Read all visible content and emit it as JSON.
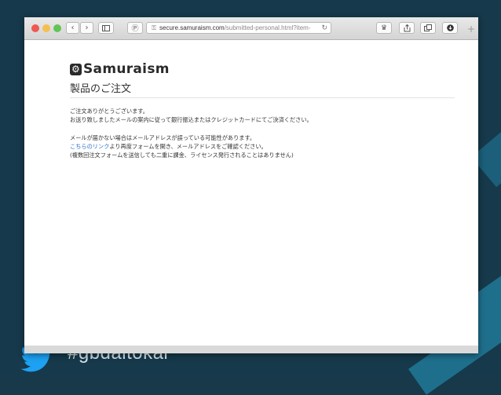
{
  "browser": {
    "url_host": "secure.samuraism.com",
    "url_path": "/submitted-personal.html?item-"
  },
  "page": {
    "logo_text": "Samuraism",
    "title": "製品のご注文",
    "paragraph1": {
      "line1": "ご注文ありがとうございます。",
      "line2": "お送り致しましたメールの案内に従って銀行振込またはクレジットカードにてご決済ください。"
    },
    "paragraph2": {
      "line1": "メールが届かない場合はメールアドレスが誤っている可能性があります。",
      "link_text": "こちらのリンク",
      "line2_rest": "より再度フォームを開き、メールアドレスをご確認ください。",
      "line3": "(複数回注文フォームを送信しても二重に課金、ライセンス発行されることはありません)"
    }
  },
  "slide": {
    "hashtag": "#gbdaitokai"
  },
  "colors": {
    "background": "#16394b",
    "accent_stripe": "#1e6f8c",
    "link": "#2a6fc9",
    "twitter": "#1da1f2"
  },
  "icons": [
    "back-arrow-icon",
    "forward-arrow-icon",
    "sidebar-icon",
    "reader-icon",
    "lock-icon",
    "reload-icon",
    "extension-icon",
    "share-icon",
    "tabs-icon",
    "download-icon",
    "plus-icon",
    "twitter-bird-icon"
  ]
}
